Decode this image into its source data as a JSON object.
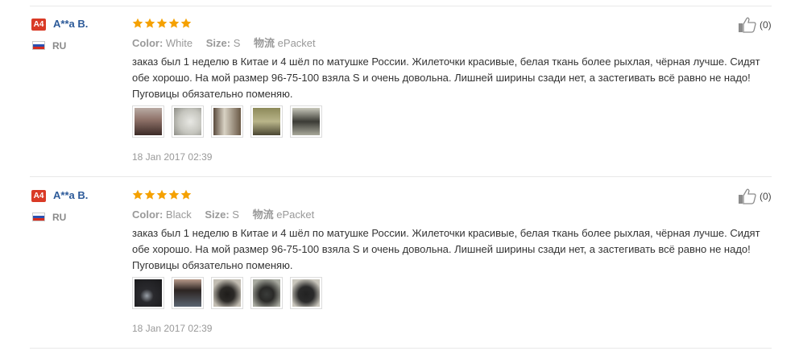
{
  "reviews": [
    {
      "badge": "A4",
      "username": "A**a B.",
      "country": "RU",
      "rating": 5,
      "color_label": "Color:",
      "color_value": "White",
      "size_label": "Size:",
      "size_value": "S",
      "shipping_label": "物流",
      "shipping_value": "ePacket",
      "text_line1": "заказ был 1 неделю в Китае и 4 шёл по матушке России. Жилеточки красивые, белая ткань более рыхлая, чёрная лучше. Сидят",
      "text_line2": "обе хорошо. На мой размер 96-75-100 взяла S и очень довольна. Лишней ширины сзади нет, а застегивать всё равно не надо!",
      "text_line3": "Пуговицы обязательно поменяю.",
      "photos": 5,
      "date": "18 Jan 2017 02:39",
      "helpful_count": "(0)"
    },
    {
      "badge": "A4",
      "username": "A**a B.",
      "country": "RU",
      "rating": 5,
      "color_label": "Color:",
      "color_value": "Black",
      "size_label": "Size:",
      "size_value": "S",
      "shipping_label": "物流",
      "shipping_value": "ePacket",
      "text_line1": "заказ был 1 неделю в Китае и 4 шёл по матушке России. Жилеточки красивые, белая ткань более рыхлая, чёрная лучше. Сидят",
      "text_line2": "обе хорошо. На мой размер 96-75-100 взяла S и очень довольна. Лишней ширины сзади нет, а застегивать всё равно не надо!",
      "text_line3": "Пуговицы обязательно поменяю.",
      "photos": 5,
      "date": "18 Jan 2017 02:39",
      "helpful_count": "(0)"
    }
  ],
  "colors": {
    "star": "#f5a100",
    "badge": "#d93a26",
    "username": "#2c5a99",
    "meta_text": "#999999"
  }
}
